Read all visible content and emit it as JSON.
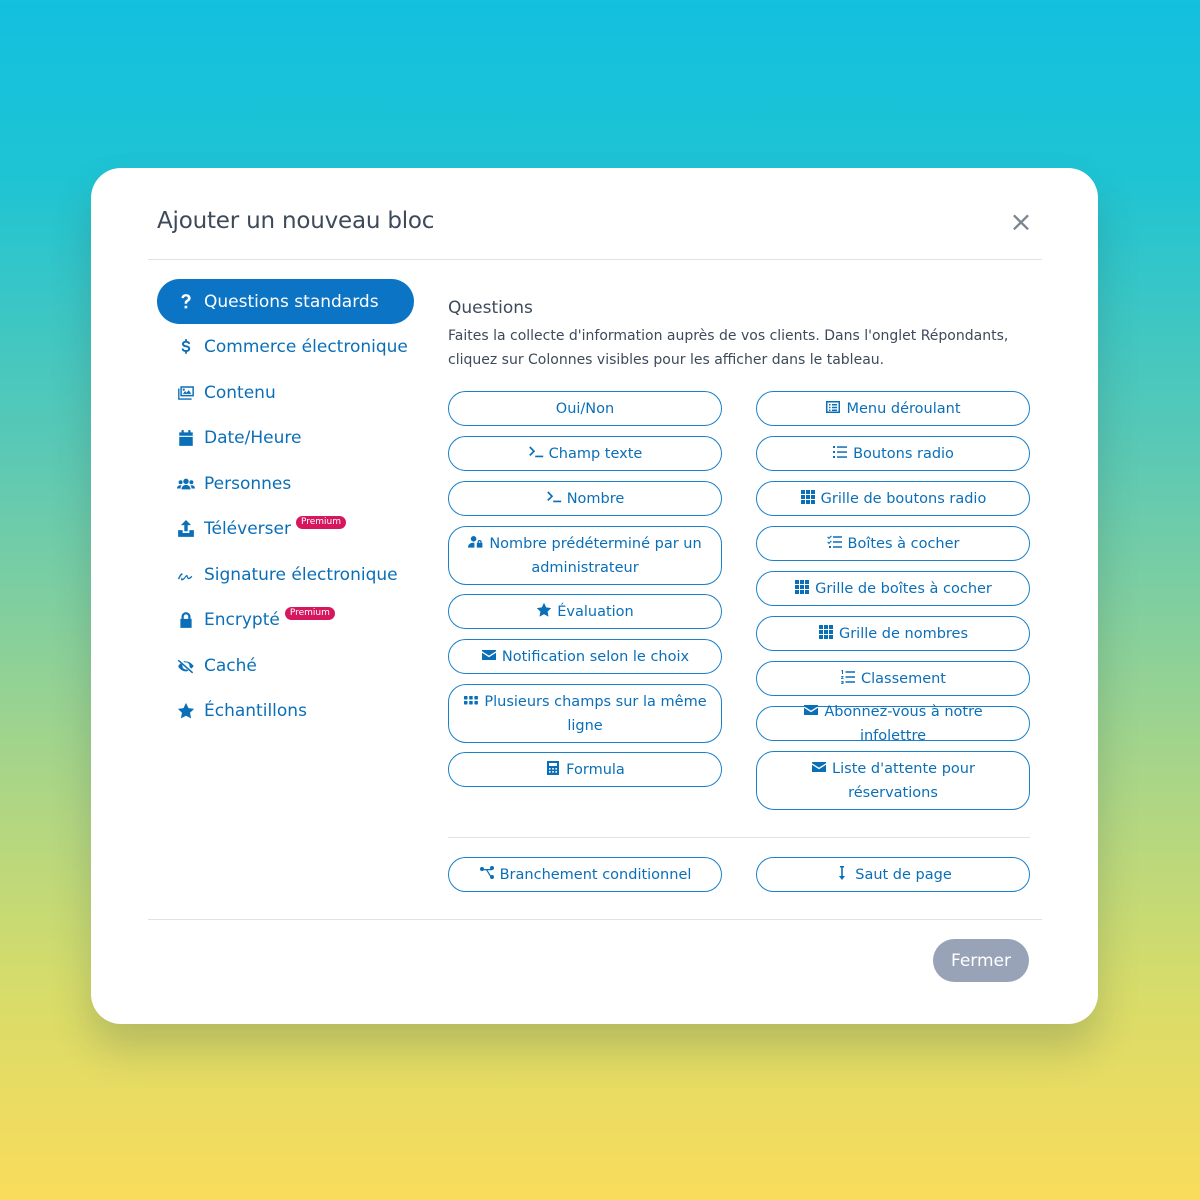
{
  "modal": {
    "title": "Ajouter un nouveau bloc",
    "close_symbol": "×"
  },
  "sidebar": {
    "items": [
      {
        "label": "Questions standards",
        "icon": "question-icon",
        "active": true
      },
      {
        "label": "Commerce électronique",
        "icon": "dollar-icon"
      },
      {
        "label": "Contenu",
        "icon": "images-icon"
      },
      {
        "label": "Date/Heure",
        "icon": "calendar-icon"
      },
      {
        "label": "Personnes",
        "icon": "users-icon"
      },
      {
        "label": "Téléverser",
        "icon": "upload-icon",
        "badge": "Premium"
      },
      {
        "label": "Signature électronique",
        "icon": "signature-icon"
      },
      {
        "label": "Encrypté",
        "icon": "lock-icon",
        "badge": "Premium"
      },
      {
        "label": "Caché",
        "icon": "eye-slash-icon"
      },
      {
        "label": "Échantillons",
        "icon": "star-icon"
      }
    ]
  },
  "content": {
    "title": "Questions",
    "description": "Faites la collecte d'information auprès de vos clients. Dans l'onglet Répondants, cliquez sur Colonnes visibles pour les afficher dans le tableau.",
    "left_options": [
      {
        "label": "Oui/Non",
        "icon": ""
      },
      {
        "label": "Champ texte",
        "icon": "terminal-icon"
      },
      {
        "label": "Nombre",
        "icon": "terminal-icon"
      },
      {
        "label": "Nombre prédéterminé par un administrateur",
        "icon": "user-lock-icon"
      },
      {
        "label": "Évaluation",
        "icon": "star-icon"
      },
      {
        "label": "Notification selon le choix",
        "icon": "envelope-icon"
      },
      {
        "label": "Plusieurs champs sur la même ligne",
        "icon": "grip-icon"
      },
      {
        "label": "Formula",
        "icon": "calculator-icon"
      }
    ],
    "right_options": [
      {
        "label": "Menu déroulant",
        "icon": "list-alt-icon"
      },
      {
        "label": "Boutons radio",
        "icon": "list-icon"
      },
      {
        "label": "Grille de boutons radio",
        "icon": "grid-icon"
      },
      {
        "label": "Boîtes à cocher",
        "icon": "list-check-icon"
      },
      {
        "label": "Grille de boîtes à cocher",
        "icon": "grid-icon"
      },
      {
        "label": "Grille de nombres",
        "icon": "grid-icon"
      },
      {
        "label": "Classement",
        "icon": "list-ol-icon"
      },
      {
        "label": "Abonnez-vous à notre infolettre",
        "icon": "envelope-icon"
      },
      {
        "label": "Liste d'attente pour réservations",
        "icon": "envelope-icon"
      }
    ],
    "bottom_options": [
      {
        "label": "Branchement conditionnel",
        "icon": "branch-icon"
      },
      {
        "label": "Saut de page",
        "icon": "arrow-down-icon"
      }
    ]
  },
  "footer": {
    "close_label": "Fermer"
  },
  "colors": {
    "accent": "#0b74c4",
    "badge": "#d6175e",
    "close_button": "#98a3b8"
  }
}
